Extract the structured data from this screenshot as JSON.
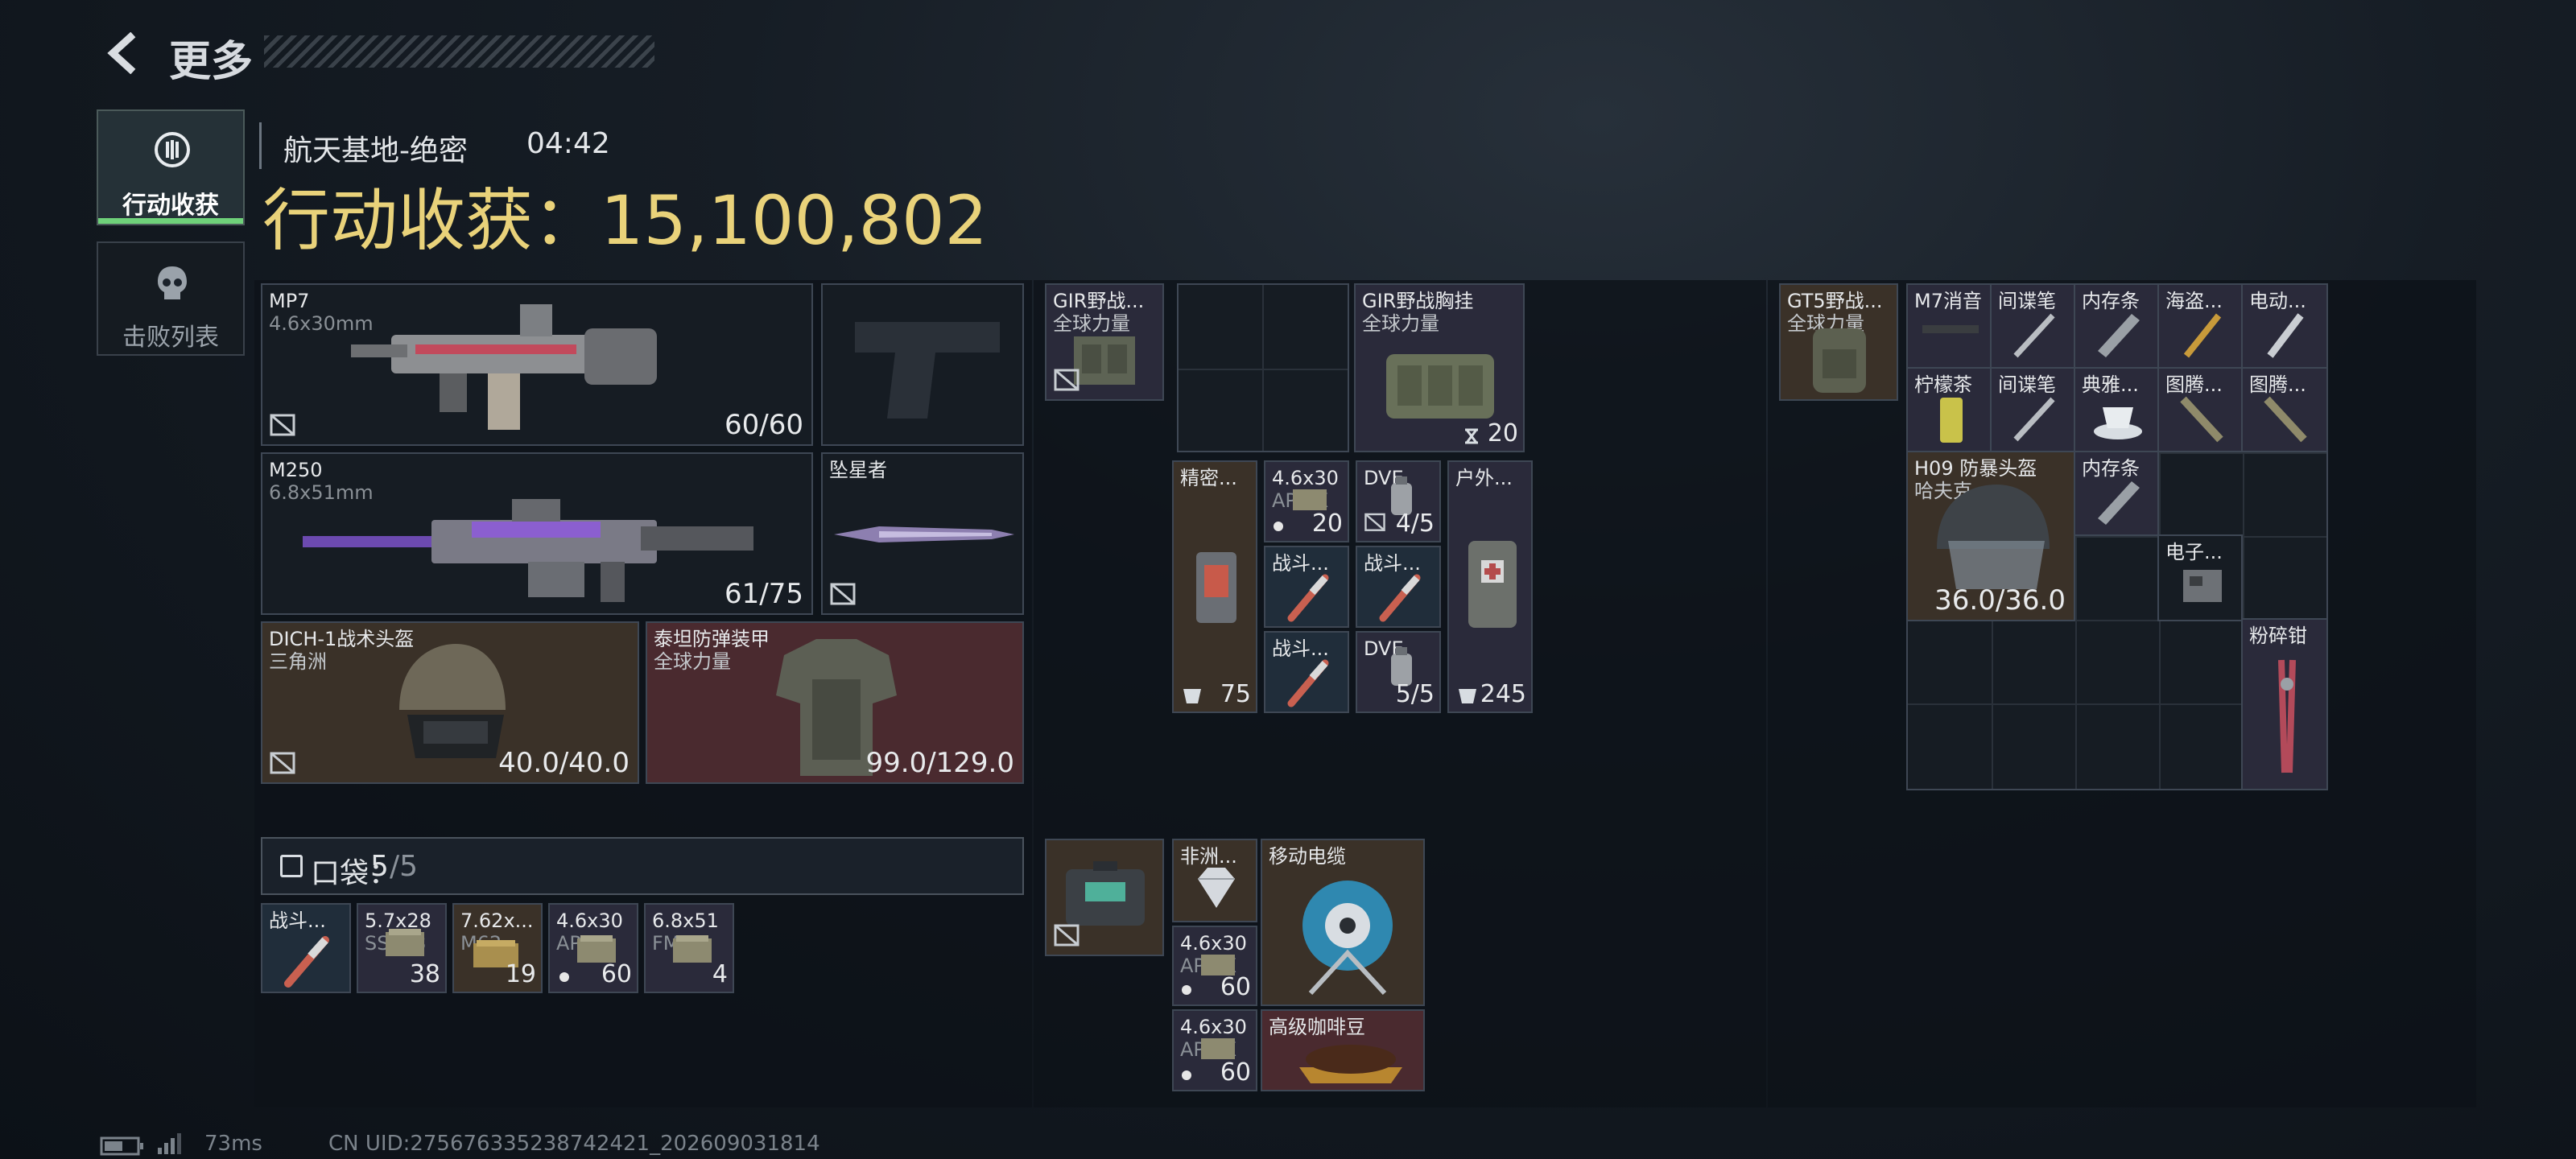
{
  "header": {
    "back_label": "更多"
  },
  "side_tabs": [
    {
      "label": "行动收获",
      "active": true
    },
    {
      "label": "击败列表",
      "active": false
    }
  ],
  "mission": {
    "map": "航天基地-绝密",
    "time": "04:42",
    "haul_label": "行动收获：",
    "haul_value": "15,100,802"
  },
  "loadout": {
    "primary": {
      "name": "MP7",
      "ammo": "4.6x30mm",
      "count": "60/60"
    },
    "secondary": {
      "name": "M250",
      "ammo": "6.8x51mm",
      "count": "61/75"
    },
    "melee": {
      "name": "坠星者"
    },
    "helmet": {
      "name": "DICH-1战术头盔",
      "faction": "三角洲",
      "durability": "40.0/40.0"
    },
    "armor": {
      "name": "泰坦防弹装甲",
      "faction": "全球力量",
      "durability": "99.0/129.0"
    },
    "pocket": {
      "label": "口袋：",
      "used": "5",
      "total": "/5"
    },
    "pocket_items": [
      {
        "line1": "战斗...",
        "line2": "",
        "count": ""
      },
      {
        "line1": "5.7x28",
        "line2": "SS198",
        "count": "38"
      },
      {
        "line1": "7.62x...",
        "line2": "M62",
        "count": "19"
      },
      {
        "line1": "4.6x30",
        "line2": "AP SX",
        "count": "60"
      },
      {
        "line1": "6.8x51",
        "line2": "FMJ",
        "count": "4"
      }
    ]
  },
  "rig": {
    "small": {
      "name": "GIR野战...",
      "faction": "全球力量"
    },
    "large": {
      "name": "GIR野战胸挂",
      "faction": "全球力量",
      "count": "20"
    },
    "items": [
      {
        "name": "精密...",
        "count": "75"
      },
      {
        "name": "4.6x30",
        "sub": "AP SX",
        "count": "20"
      },
      {
        "name": "DVE",
        "count": "4/5"
      },
      {
        "name": "户外...",
        "count": "245"
      },
      {
        "name": "战斗..."
      },
      {
        "name": "战斗..."
      },
      {
        "name": "战斗..."
      },
      {
        "name": "DVE",
        "count": "5/5"
      }
    ],
    "safe": {
      "name": ""
    },
    "safe_items": [
      {
        "name": "非洲...",
        "count": ""
      },
      {
        "name": "移动电缆",
        "count": ""
      },
      {
        "name": "4.6x30",
        "sub": "AP SX",
        "count": "60"
      },
      {
        "name": "4.6x30",
        "sub": "AP SX",
        "count": "60"
      },
      {
        "name": "高级咖啡豆",
        "count": ""
      }
    ]
  },
  "backpack": {
    "bag": {
      "name": "GT5野战...",
      "faction": "全球力量"
    },
    "items": [
      {
        "name": "M7消音"
      },
      {
        "name": "间谍笔"
      },
      {
        "name": "内存条"
      },
      {
        "name": "海盗..."
      },
      {
        "name": "电动..."
      },
      {
        "name": "柠檬茶"
      },
      {
        "name": "间谍笔"
      },
      {
        "name": "典雅..."
      },
      {
        "name": "图腾..."
      },
      {
        "name": "图腾..."
      },
      {
        "name": "内存条"
      },
      {
        "name": "电子..."
      },
      {
        "name": "粉碎钳"
      }
    ],
    "helmet": {
      "name": "H09 防暴头盔",
      "faction": "哈夫克",
      "durability": "36.0/36.0"
    }
  },
  "footer": {
    "ping": "73ms",
    "uid": "CN UID:275676335238742421_202609031814"
  },
  "colors": {
    "gold": "#e9d27a",
    "accent_green": "#6fd17a",
    "frame": "#3e4754"
  }
}
